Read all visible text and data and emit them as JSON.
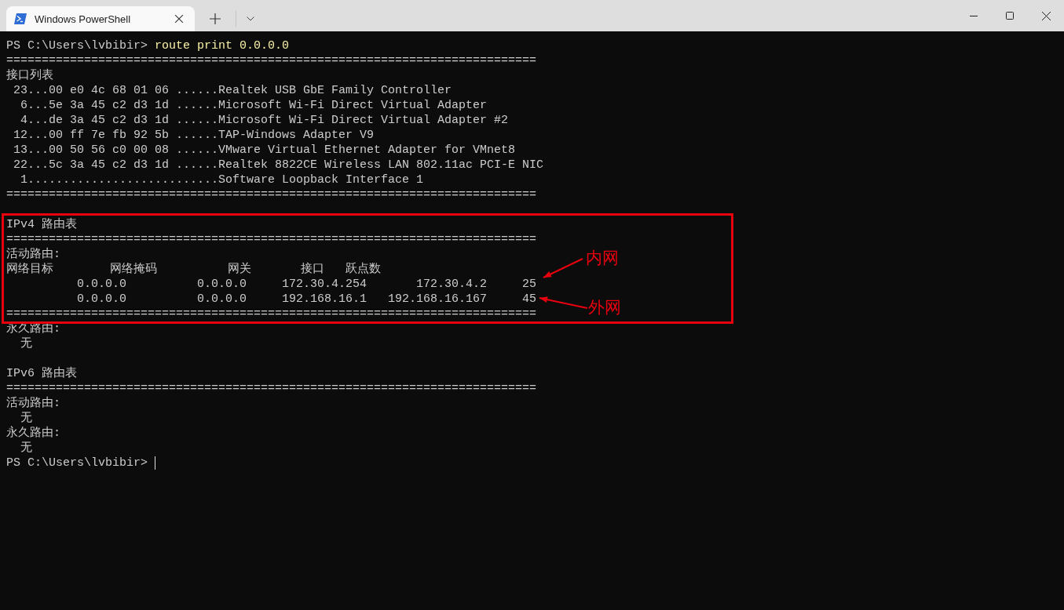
{
  "tab": {
    "title": "Windows PowerShell",
    "selected": true
  },
  "terminal": {
    "blocks": [
      {
        "kind": "lines",
        "lines": [
          {
            "kind": "command",
            "prompt": "PS C:\\Users\\lvbibir>",
            "command": "route print 0.0.0.0"
          },
          {
            "kind": "text",
            "text": "==========================================================================="
          },
          {
            "kind": "text",
            "text": "接口列表"
          },
          {
            "kind": "text",
            "text": " 23...00 e0 4c 68 01 06 ......Realtek USB GbE Family Controller"
          },
          {
            "kind": "text",
            "text": "  6...5e 3a 45 c2 d3 1d ......Microsoft Wi-Fi Direct Virtual Adapter"
          },
          {
            "kind": "text",
            "text": "  4...de 3a 45 c2 d3 1d ......Microsoft Wi-Fi Direct Virtual Adapter #2"
          },
          {
            "kind": "text",
            "text": " 12...00 ff 7e fb 92 5b ......TAP-Windows Adapter V9"
          },
          {
            "kind": "text",
            "text": " 13...00 50 56 c0 00 08 ......VMware Virtual Ethernet Adapter for VMnet8"
          },
          {
            "kind": "text",
            "text": " 22...5c 3a 45 c2 d3 1d ......Realtek 8822CE Wireless LAN 802.11ac PCI-E NIC"
          },
          {
            "kind": "text",
            "text": "  1...........................Software Loopback Interface 1"
          },
          {
            "kind": "text",
            "text": "==========================================================================="
          },
          {
            "kind": "blank"
          }
        ]
      },
      {
        "kind": "highlight",
        "lines": [
          {
            "kind": "text",
            "text": "IPv4 路由表"
          },
          {
            "kind": "text",
            "text": "==========================================================================="
          },
          {
            "kind": "text",
            "text": "活动路由:"
          },
          {
            "kind": "text",
            "text": "网络目标        网络掩码          网关       接口   跃点数"
          },
          {
            "kind": "text",
            "text": "          0.0.0.0          0.0.0.0     172.30.4.254       172.30.4.2     25"
          },
          {
            "kind": "text",
            "text": "          0.0.0.0          0.0.0.0     192.168.16.1   192.168.16.167     45"
          },
          {
            "kind": "text",
            "text": "==========================================================================="
          }
        ],
        "annotations": [
          {
            "label": "内网"
          },
          {
            "label": "外网"
          }
        ]
      },
      {
        "kind": "lines",
        "lines": [
          {
            "kind": "text",
            "text": "永久路由:"
          },
          {
            "kind": "text",
            "text": "  无"
          },
          {
            "kind": "blank"
          },
          {
            "kind": "text",
            "text": "IPv6 路由表"
          },
          {
            "kind": "text",
            "text": "==========================================================================="
          },
          {
            "kind": "text",
            "text": "活动路由:"
          },
          {
            "kind": "text",
            "text": "  无"
          },
          {
            "kind": "text",
            "text": "永久路由:"
          },
          {
            "kind": "text",
            "text": "  无"
          },
          {
            "kind": "prompt",
            "prompt": "PS C:\\Users\\lvbibir>",
            "cursor": true
          }
        ]
      }
    ]
  }
}
